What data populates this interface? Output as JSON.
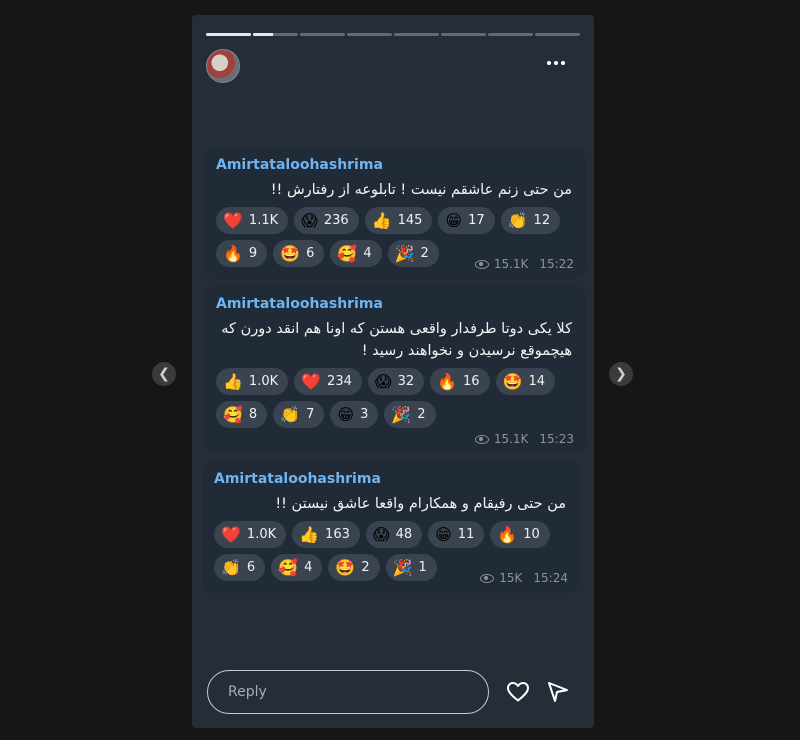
{
  "story": {
    "progress": [
      1,
      0.45,
      0,
      0,
      0,
      0,
      0,
      0
    ]
  },
  "messages": [
    {
      "author": "Amirtataloohashrima",
      "text": "من حتی زنم عاشقم نیست ! تابلوعه از رفتارش !!",
      "reactions": [
        {
          "emoji": "❤️",
          "count": "1.1K"
        },
        {
          "emoji": "😱",
          "count": "236"
        },
        {
          "emoji": "👍",
          "count": "145"
        },
        {
          "emoji": "😁",
          "count": "17"
        },
        {
          "emoji": "👏",
          "count": "12"
        },
        {
          "emoji": "🔥",
          "count": "9"
        },
        {
          "emoji": "🤩",
          "count": "6"
        },
        {
          "emoji": "🥰",
          "count": "4"
        },
        {
          "emoji": "🎉",
          "count": "2"
        }
      ],
      "views": "15.1K",
      "time": "15:22"
    },
    {
      "author": "Amirtataloohashrima",
      "text": "کلا یکی دوتا طرفدار واقعی هستن که اونا هم انقد دورن که هیچموقع نرسیدن و نخواهند رسید !",
      "reactions": [
        {
          "emoji": "👍",
          "count": "1.0K"
        },
        {
          "emoji": "❤️",
          "count": "234"
        },
        {
          "emoji": "😱",
          "count": "32"
        },
        {
          "emoji": "🔥",
          "count": "16"
        },
        {
          "emoji": "🤩",
          "count": "14"
        },
        {
          "emoji": "🥰",
          "count": "8"
        },
        {
          "emoji": "👏",
          "count": "7"
        },
        {
          "emoji": "😁",
          "count": "3"
        },
        {
          "emoji": "🎉",
          "count": "2"
        }
      ],
      "views": "15.1K",
      "time": "15:23"
    },
    {
      "author": "Amirtataloohashrima",
      "text": "من حتی رفیقام و همکارام واقعا عاشق نیستن !!",
      "reactions": [
        {
          "emoji": "❤️",
          "count": "1.0K"
        },
        {
          "emoji": "👍",
          "count": "163"
        },
        {
          "emoji": "😱",
          "count": "48"
        },
        {
          "emoji": "😁",
          "count": "11"
        },
        {
          "emoji": "🔥",
          "count": "10"
        },
        {
          "emoji": "👏",
          "count": "6"
        },
        {
          "emoji": "🥰",
          "count": "4"
        },
        {
          "emoji": "🤩",
          "count": "2"
        },
        {
          "emoji": "🎉",
          "count": "1"
        }
      ],
      "views": "15K",
      "time": "15:24"
    }
  ],
  "reply": {
    "placeholder": "Reply"
  },
  "icons": {
    "more": "more-horizontal-icon",
    "heart": "heart-outline-icon",
    "send": "send-icon",
    "prev": "chevron-left-icon",
    "next": "chevron-right-icon"
  }
}
